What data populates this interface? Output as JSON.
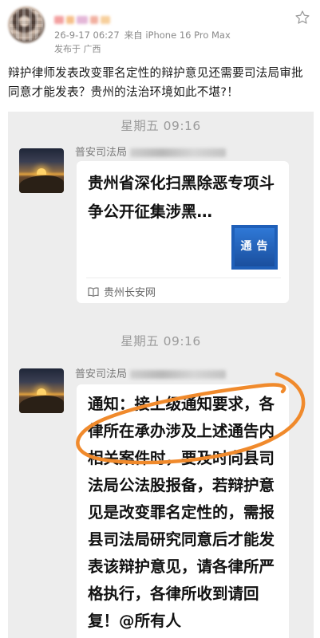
{
  "post": {
    "timestamp": "26-9-17 06:27",
    "device": "来自 iPhone 16 Pro Max",
    "location": "发布于 广西",
    "text": "辩护律师发表改变罪名定性的辩护意见还需要司法局审批同意才能发表？贵州的法治环境如此不堪?！"
  },
  "chat": {
    "time_1": "星期五 09:16",
    "time_2": "星期五 09:16",
    "sender_1": "普安司法局",
    "sender_2": "普安司法局",
    "card": {
      "title": "贵州省深化扫黑除恶专项斗争公开征集涉黑…",
      "thumb_text": "通告",
      "source": "贵州长安网"
    },
    "message": "通知：接上级通知要求，各律所在承办涉及上述通告内相关案件时，要及时向县司法局公法股报备，若辩护意见是改变罪名定性的，需报县司法局研究同意后才能发表该辩护意见，请各律所严格执行，各律所收到请回复！@所有人"
  },
  "colors": {
    "chat_background": "#ededed",
    "annotation": "#f08a2c",
    "thumb_blue": "#1f5fb8"
  },
  "icons": {
    "favorite": "star-outline-icon",
    "source": "open-book-icon"
  }
}
